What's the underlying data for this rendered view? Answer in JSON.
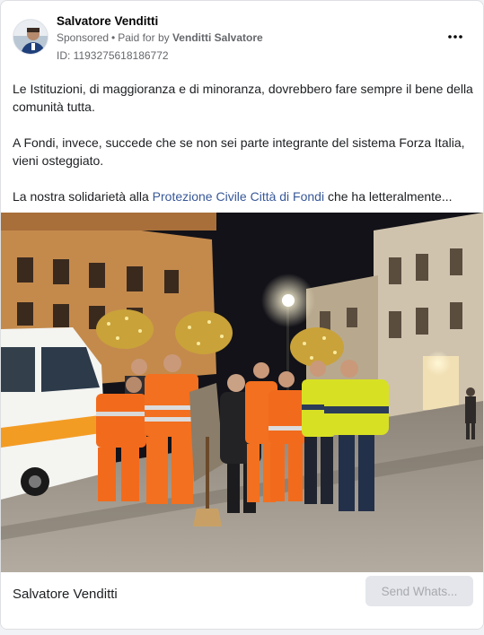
{
  "ad": {
    "page_name": "Salvatore Venditti",
    "sponsored_label": "Sponsored",
    "separator": "•",
    "paid_for_prefix": "Paid for by",
    "paid_for_by": "Venditti Salvatore",
    "ad_id": "ID: 1193275618186772",
    "more_icon": "more-options-icon",
    "avatar_icon": "page-avatar"
  },
  "post": {
    "paragraph_1": "Le Istituzioni, di maggioranza e di minoranza, dovrebbero fare sempre il bene della comunità tutta.",
    "paragraph_2": "A Fondi, invece, succede che se non sei parte integrante del sistema Forza Italia, vieni osteggiato.",
    "paragraph_3_before": "La nostra solidarietà alla ",
    "paragraph_3_link": "Protezione Civile Città di Fondi",
    "paragraph_3_after": " che ha letteralmente..."
  },
  "footer": {
    "name": "Salvatore Venditti",
    "cta_label": "Send Whats..."
  },
  "colors": {
    "link": "#385898",
    "secondary_text": "#65676b",
    "button_bg": "#e4e6eb"
  }
}
